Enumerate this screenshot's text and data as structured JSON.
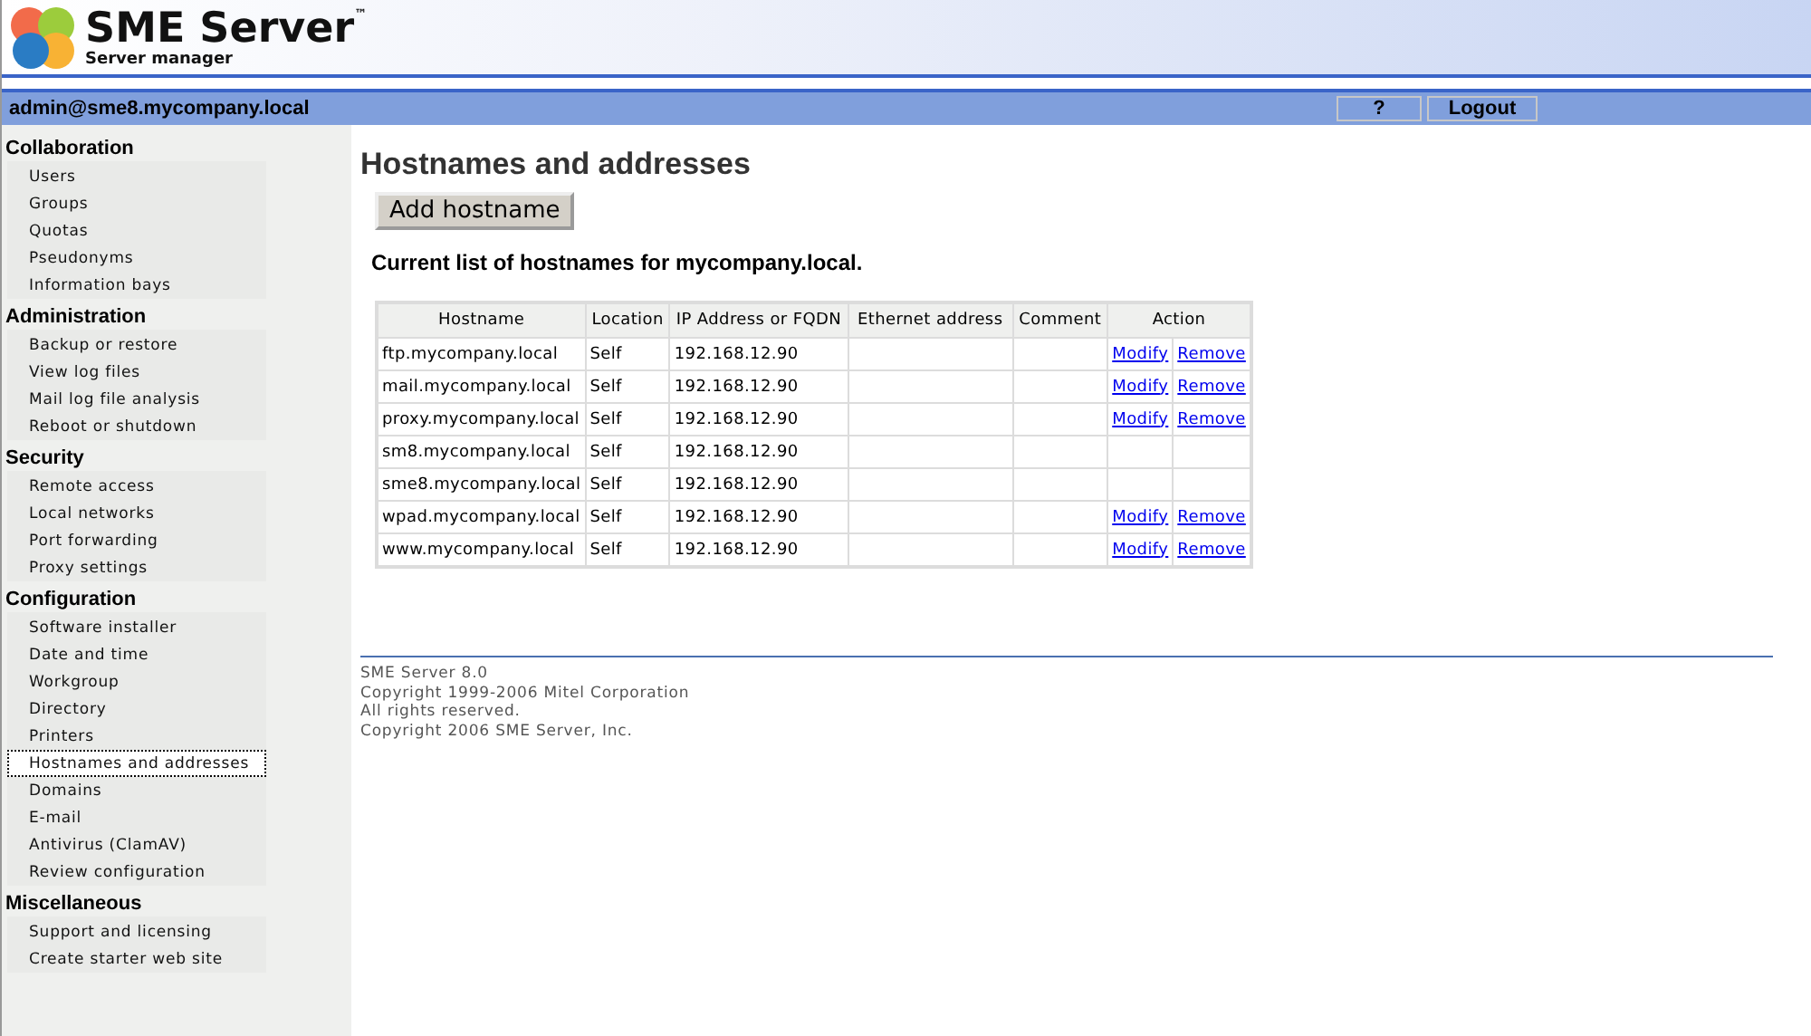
{
  "header": {
    "logo_title": "SME Server$^{™}$",
    "logo_subtitle": "Server manager"
  },
  "user_bar": {
    "user": "admin@sme8.mycompany.local",
    "buttons": [
      "?",
      "Logout"
    ]
  },
  "sidebar": [
    {
      "heading": "Collaboration",
      "items": [
        {
          "label": "Users",
          "selected": false
        },
        {
          "label": "Groups",
          "selected": false
        },
        {
          "label": "Quotas",
          "selected": false
        },
        {
          "label": "Pseudonyms",
          "selected": false
        },
        {
          "label": "Information bays",
          "selected": false
        }
      ]
    },
    {
      "heading": "Administration",
      "items": [
        {
          "label": "Backup or restore",
          "selected": false
        },
        {
          "label": "View log files",
          "selected": false
        },
        {
          "label": "Mail log file analysis",
          "selected": false
        },
        {
          "label": "Reboot or shutdown",
          "selected": false
        }
      ]
    },
    {
      "heading": "Security",
      "items": [
        {
          "label": "Remote access",
          "selected": false
        },
        {
          "label": "Local networks",
          "selected": false
        },
        {
          "label": "Port forwarding",
          "selected": false
        },
        {
          "label": "Proxy settings",
          "selected": false
        }
      ]
    },
    {
      "heading": "Configuration",
      "items": [
        {
          "label": "Software installer",
          "selected": false
        },
        {
          "label": "Date and time",
          "selected": false
        },
        {
          "label": "Workgroup",
          "selected": false
        },
        {
          "label": "Directory",
          "selected": false
        },
        {
          "label": "Printers",
          "selected": false
        },
        {
          "label": "Hostnames and addresses",
          "selected": true
        },
        {
          "label": "Domains",
          "selected": false
        },
        {
          "label": "E-mail",
          "selected": false
        },
        {
          "label": "Antivirus (ClamAV)",
          "selected": false
        },
        {
          "label": "Review configuration",
          "selected": false
        }
      ]
    },
    {
      "heading": "Miscellaneous",
      "items": [
        {
          "label": "Support and licensing",
          "selected": false
        },
        {
          "label": "Create starter web site",
          "selected": false
        }
      ]
    }
  ],
  "main": {
    "title": "Hostnames and addresses",
    "add_button": "Add hostname",
    "caption": "Current list of hostnames for mycompany.local.",
    "table": {
      "columns": [
        "Hostname",
        "Location",
        "IP Address or FQDN",
        "Ethernet address",
        "Comment",
        "Action"
      ],
      "rows": [
        {
          "hostname": "ftp.mycompany.local",
          "location": "Self",
          "ip": "192.168.12.90",
          "actions": [
            "Modify",
            "Remove"
          ]
        },
        {
          "hostname": "mail.mycompany.local",
          "location": "Self",
          "ip": "192.168.12.90",
          "actions": [
            "Modify",
            "Remove"
          ]
        },
        {
          "hostname": "proxy.mycompany.local",
          "location": "Self",
          "ip": "192.168.12.90",
          "actions": [
            "Modify",
            "Remove"
          ]
        },
        {
          "hostname": "sm8.mycompany.local",
          "location": "Self",
          "ip": "192.168.12.90"
        },
        {
          "hostname": "sme8.mycompany.local",
          "location": "Self",
          "ip": "192.168.12.90"
        },
        {
          "hostname": "wpad.mycompany.local",
          "location": "Self",
          "ip": "192.168.12.90",
          "actions": [
            "Modify",
            "Remove"
          ]
        },
        {
          "hostname": "www.mycompany.local",
          "location": "Self",
          "ip": "192.168.12.90",
          "actions": [
            "Modify",
            "Remove"
          ]
        }
      ]
    }
  },
  "footer": [
    "SME Server 8.0",
    "Copyright 1999-2006 Mitel Corporation",
    "All rights reserved.",
    "Copyright 2006 SME Server, Inc."
  ]
}
